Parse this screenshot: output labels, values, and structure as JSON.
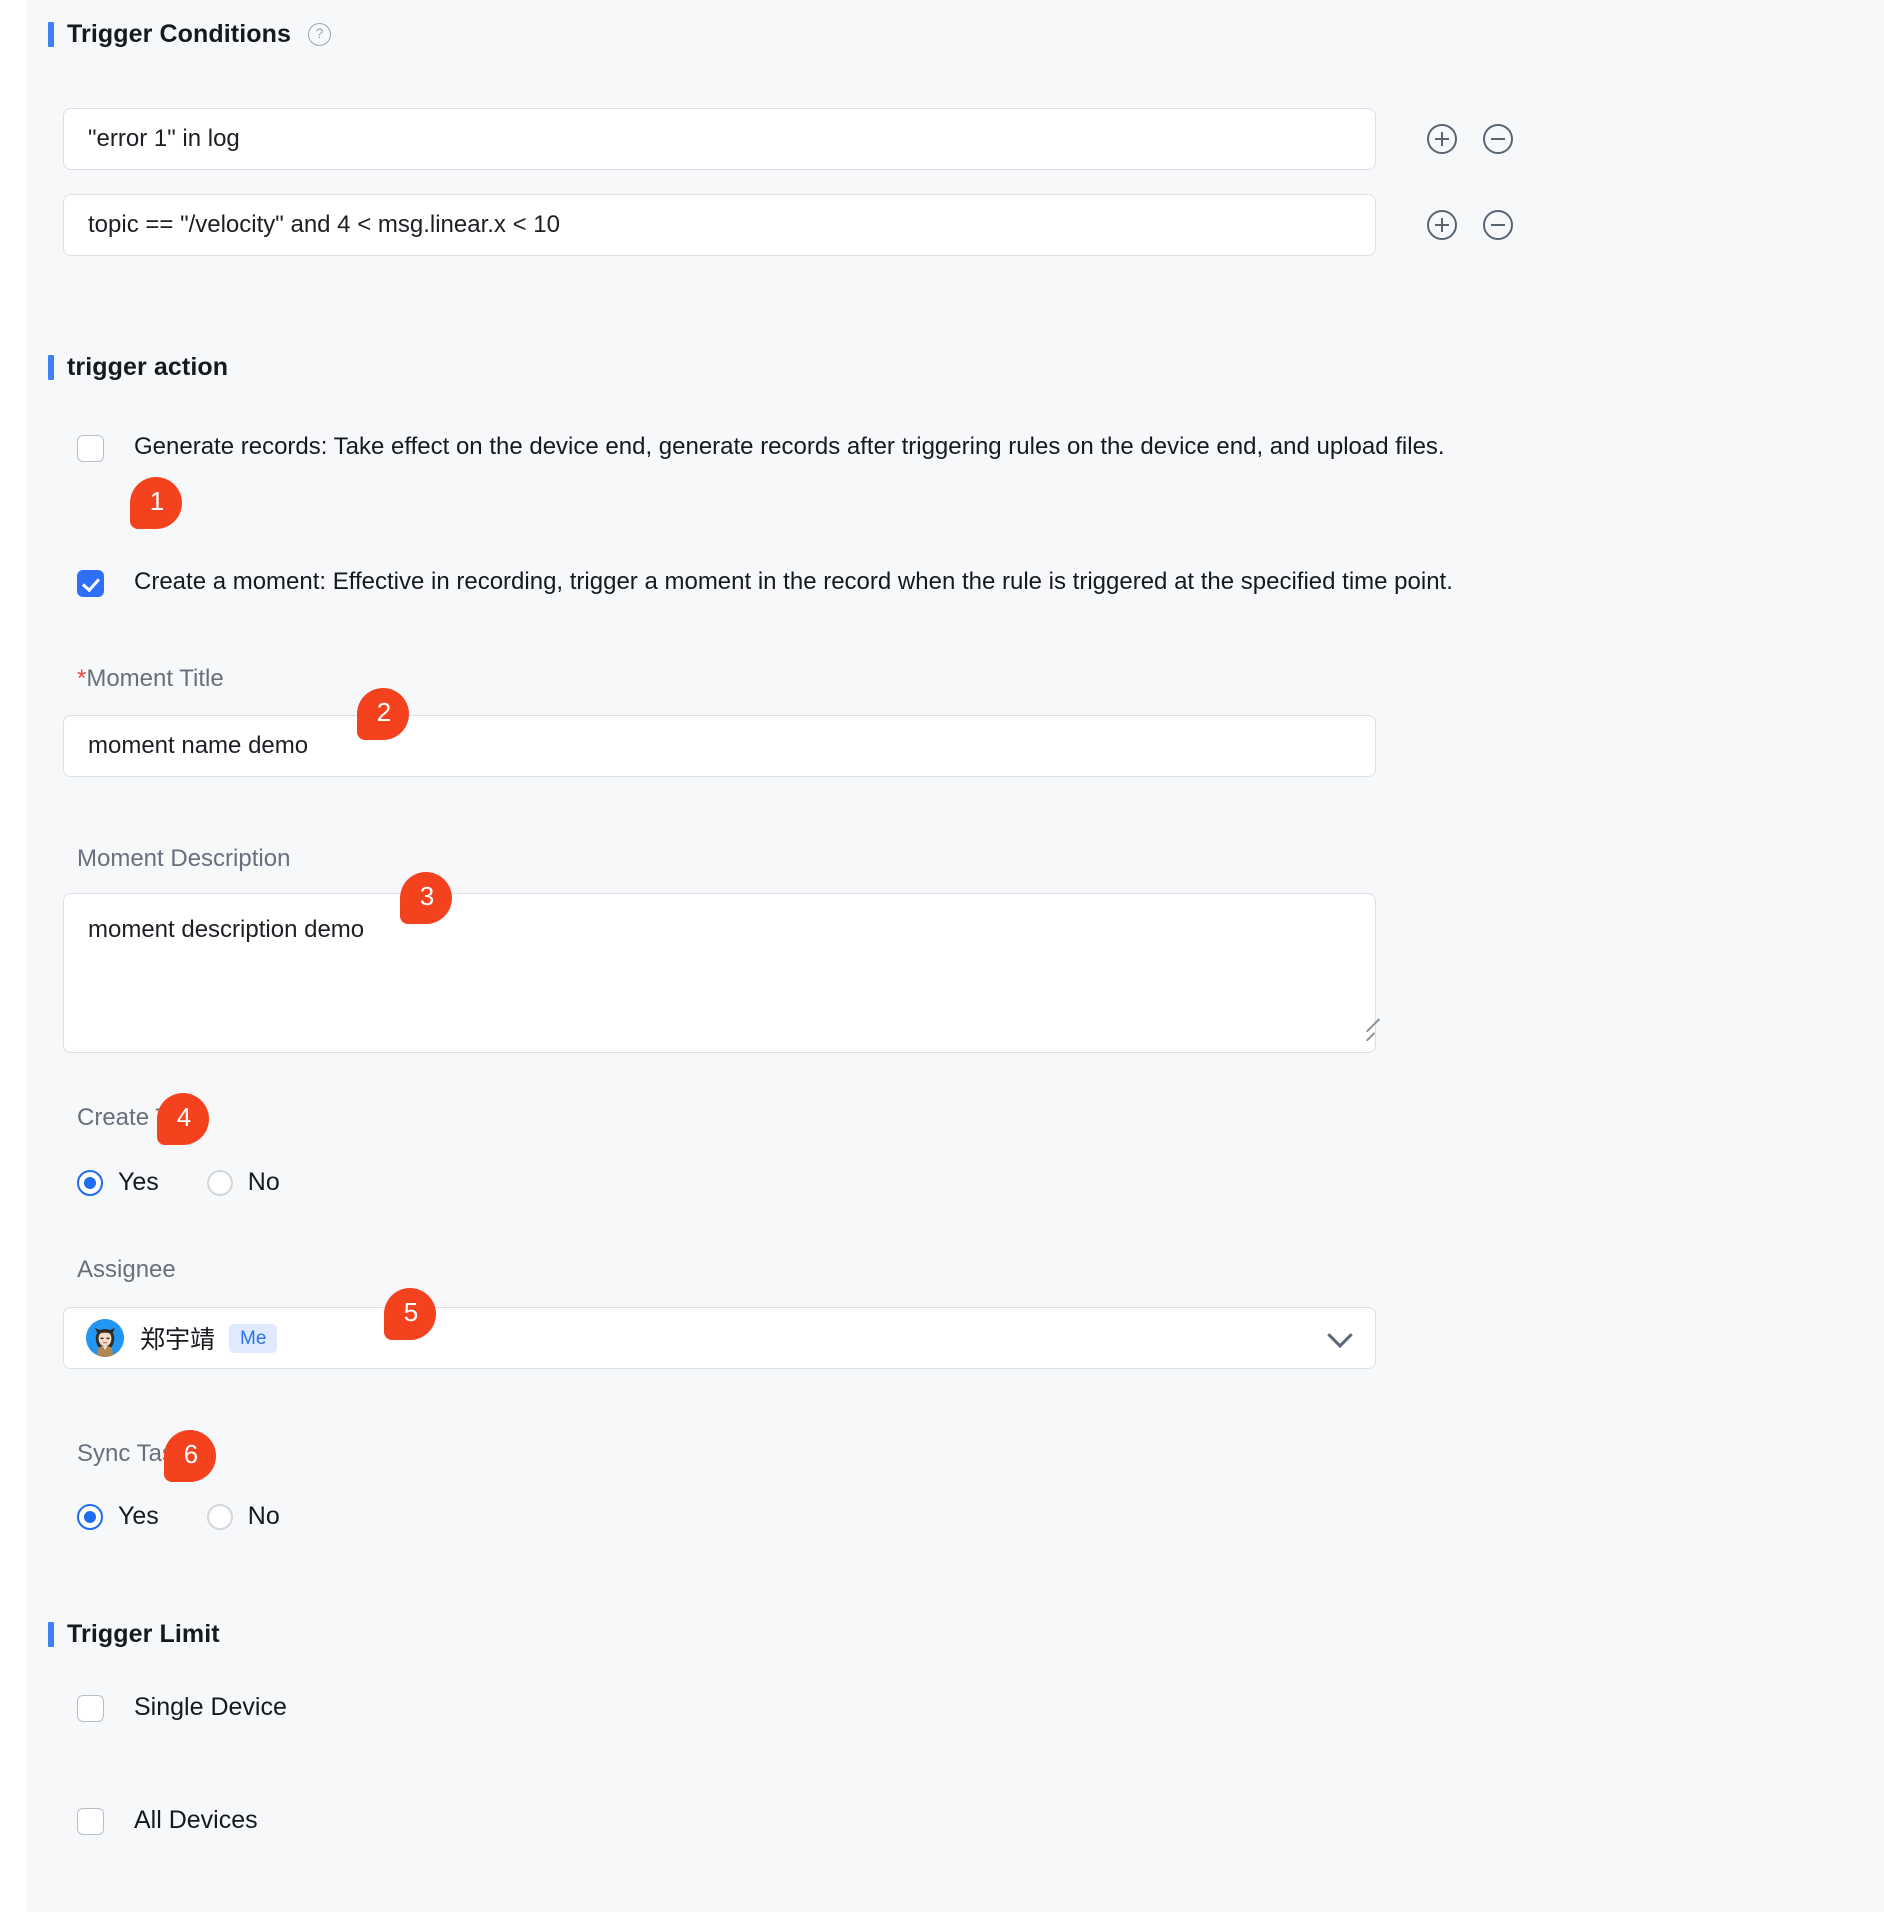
{
  "sections": {
    "trigger_conditions": {
      "title": "Trigger Conditions",
      "help_icon": "question-circle-icon",
      "conditions": [
        {
          "value": "\"error 1\" in log",
          "add_icon": "plus-circle-icon",
          "remove_icon": "minus-circle-icon"
        },
        {
          "value": "topic == \"/velocity\" and 4 < msg.linear.x < 10",
          "add_icon": "plus-circle-icon",
          "remove_icon": "minus-circle-icon"
        }
      ]
    },
    "trigger_action": {
      "title": "trigger action",
      "options": [
        {
          "label": "Generate records: Take effect on the device end, generate records after triggering rules on the device end, and upload files.",
          "checked": false
        },
        {
          "label": "Create a moment: Effective in recording, trigger a moment in the record when the rule is triggered at the specified time point.",
          "checked": true
        }
      ],
      "moment_title": {
        "label": "Moment Title",
        "required_marker": "*",
        "value": "moment name demo"
      },
      "moment_description": {
        "label": "Moment Description",
        "value": "moment description demo",
        "resize_icon": "resize-grip-icon"
      },
      "create_task": {
        "label": "Create Task",
        "options": [
          "Yes",
          "No"
        ],
        "selected": "Yes"
      },
      "assignee": {
        "label": "Assignee",
        "name": "郑宇靖",
        "tag": "Me",
        "avatar_icon": "user-avatar",
        "chevron_icon": "chevron-down-icon"
      },
      "sync_task": {
        "label": "Sync Task",
        "options": [
          "Yes",
          "No"
        ],
        "selected": "Yes"
      }
    },
    "trigger_limit": {
      "title": "Trigger Limit",
      "options": [
        {
          "label": "Single Device",
          "checked": false
        },
        {
          "label": "All Devices",
          "checked": false
        }
      ]
    }
  },
  "annotations": [
    {
      "number": "1"
    },
    {
      "number": "2"
    },
    {
      "number": "3"
    },
    {
      "number": "4"
    },
    {
      "number": "5"
    },
    {
      "number": "6"
    }
  ],
  "colors": {
    "accent": "#3c82f6",
    "badge": "#f5421e",
    "background": "#f7f8fa",
    "required": "#e8483b",
    "tag_text": "#2b72f0"
  }
}
